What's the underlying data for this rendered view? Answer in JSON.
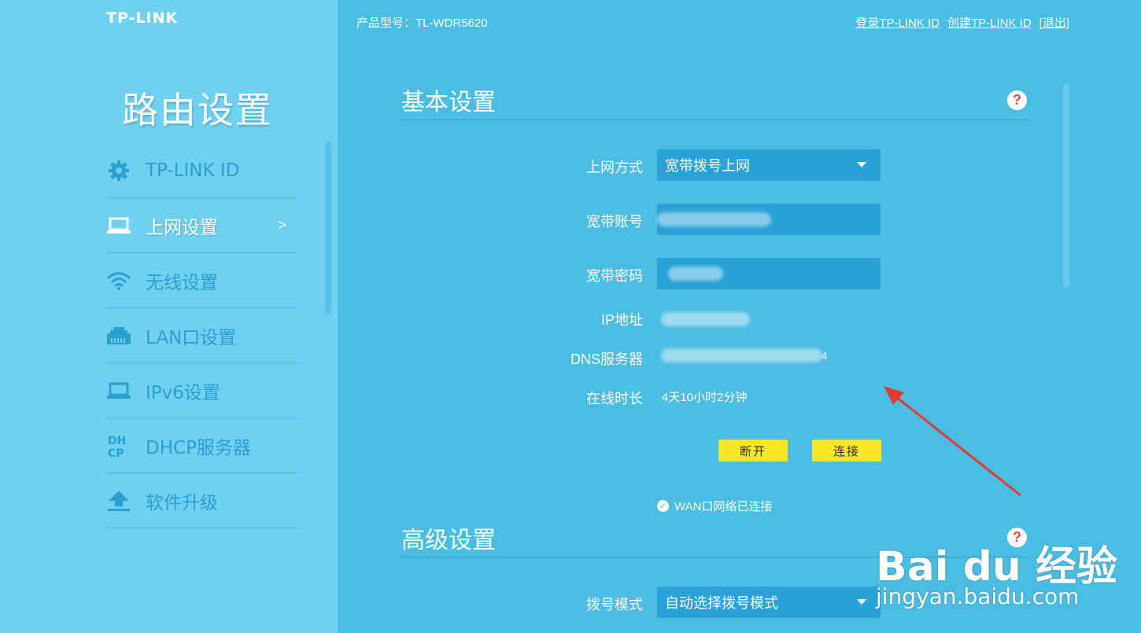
{
  "brand": "TP-LINK",
  "sidebar": {
    "title": "路由设置",
    "items": [
      {
        "label": "TP-LINK ID",
        "icon": "gear-icon"
      },
      {
        "label": "上网设置",
        "icon": "laptop-icon",
        "chevron": ">"
      },
      {
        "label": "无线设置",
        "icon": "wifi-icon"
      },
      {
        "label": "LAN口设置",
        "icon": "lan-port-icon"
      },
      {
        "label": "IPv6设置",
        "icon": "laptop-icon"
      },
      {
        "label": "DHCP服务器",
        "icon": "dhcp-icon"
      },
      {
        "label": "软件升级",
        "icon": "upload-icon"
      }
    ]
  },
  "header": {
    "model": "产品型号：TL-WDR5620",
    "login_link": "登录TP-LINK ID",
    "create_link": "创建TP-LINK ID",
    "logout_link": "[退出]"
  },
  "basic": {
    "title": "基本设置",
    "help": "?",
    "conn_type_label": "上网方式",
    "conn_type_value": "宽带拨号上网",
    "account_label": "宽带账号",
    "password_label": "宽带密码",
    "ip_label": "IP地址",
    "dns_label": "DNS服务器",
    "dns_tail": "4",
    "uptime_label": "在线时长",
    "uptime_value": "4天10小时2分钟",
    "disconnect_btn": "断开",
    "connect_btn": "连接",
    "status": "WAN口网络已连接"
  },
  "advanced": {
    "title": "高级设置",
    "help": "?",
    "dial_mode_label": "拨号模式",
    "dial_mode_value": "自动选择拨号模式"
  },
  "watermark": {
    "brand": "Bai du 经验",
    "url": "jingyan.baidu.com"
  },
  "colors": {
    "background": "#4bbde3",
    "sidebar": "#6fd0f0",
    "field": "#2aa2d8",
    "button": "#f7e726",
    "annotation_arrow": "#e53935"
  }
}
